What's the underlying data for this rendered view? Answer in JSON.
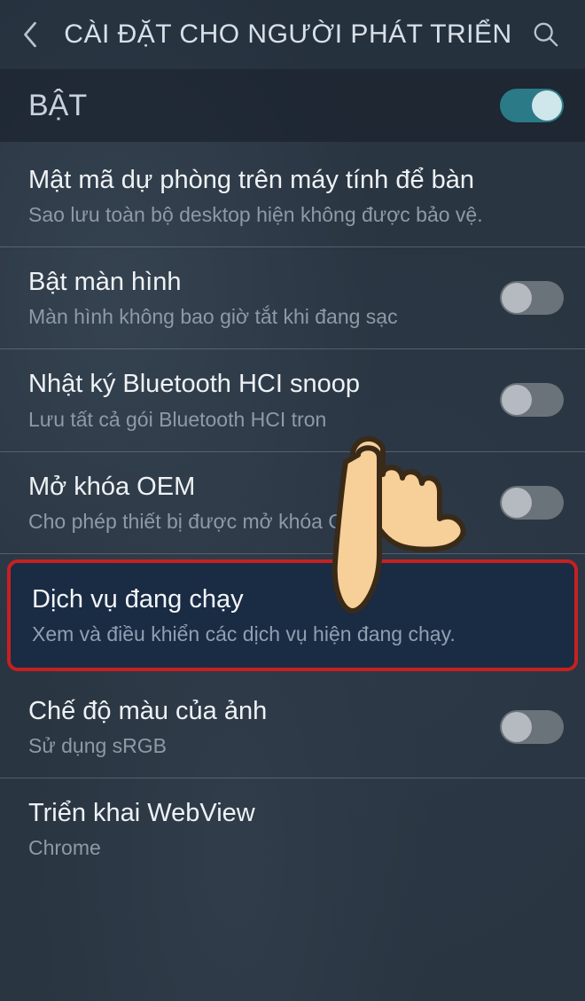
{
  "header": {
    "title": "CÀI ĐẶT CHO NGƯỜI PHÁT TRIỂN"
  },
  "master": {
    "label": "BẬT",
    "enabled": true
  },
  "items": [
    {
      "title": "Mật mã dự phòng trên máy tính để bàn",
      "sub": "Sao lưu toàn bộ desktop hiện không được bảo vệ.",
      "toggle": null,
      "highlight": false
    },
    {
      "title": "Bật màn hình",
      "sub": "Màn hình không bao giờ tắt khi đang sạc",
      "toggle": false,
      "highlight": false
    },
    {
      "title": "Nhật ký Bluetooth HCI snoop",
      "sub": "Lưu tất cả gói Bluetooth HCI tron",
      "toggle": false,
      "highlight": false
    },
    {
      "title": "Mở khóa OEM",
      "sub": "Cho phép thiết bị được mở khóa OEM.",
      "toggle": false,
      "highlight": false
    },
    {
      "title": "Dịch vụ đang chạy",
      "sub": "Xem và điều khiển các dịch vụ hiện đang chạy.",
      "toggle": null,
      "highlight": true
    },
    {
      "title": "Chế độ màu của ảnh",
      "sub": "Sử dụng sRGB",
      "toggle": false,
      "highlight": false
    },
    {
      "title": "Triển khai WebView",
      "sub": "Chrome",
      "toggle": null,
      "highlight": false
    }
  ]
}
